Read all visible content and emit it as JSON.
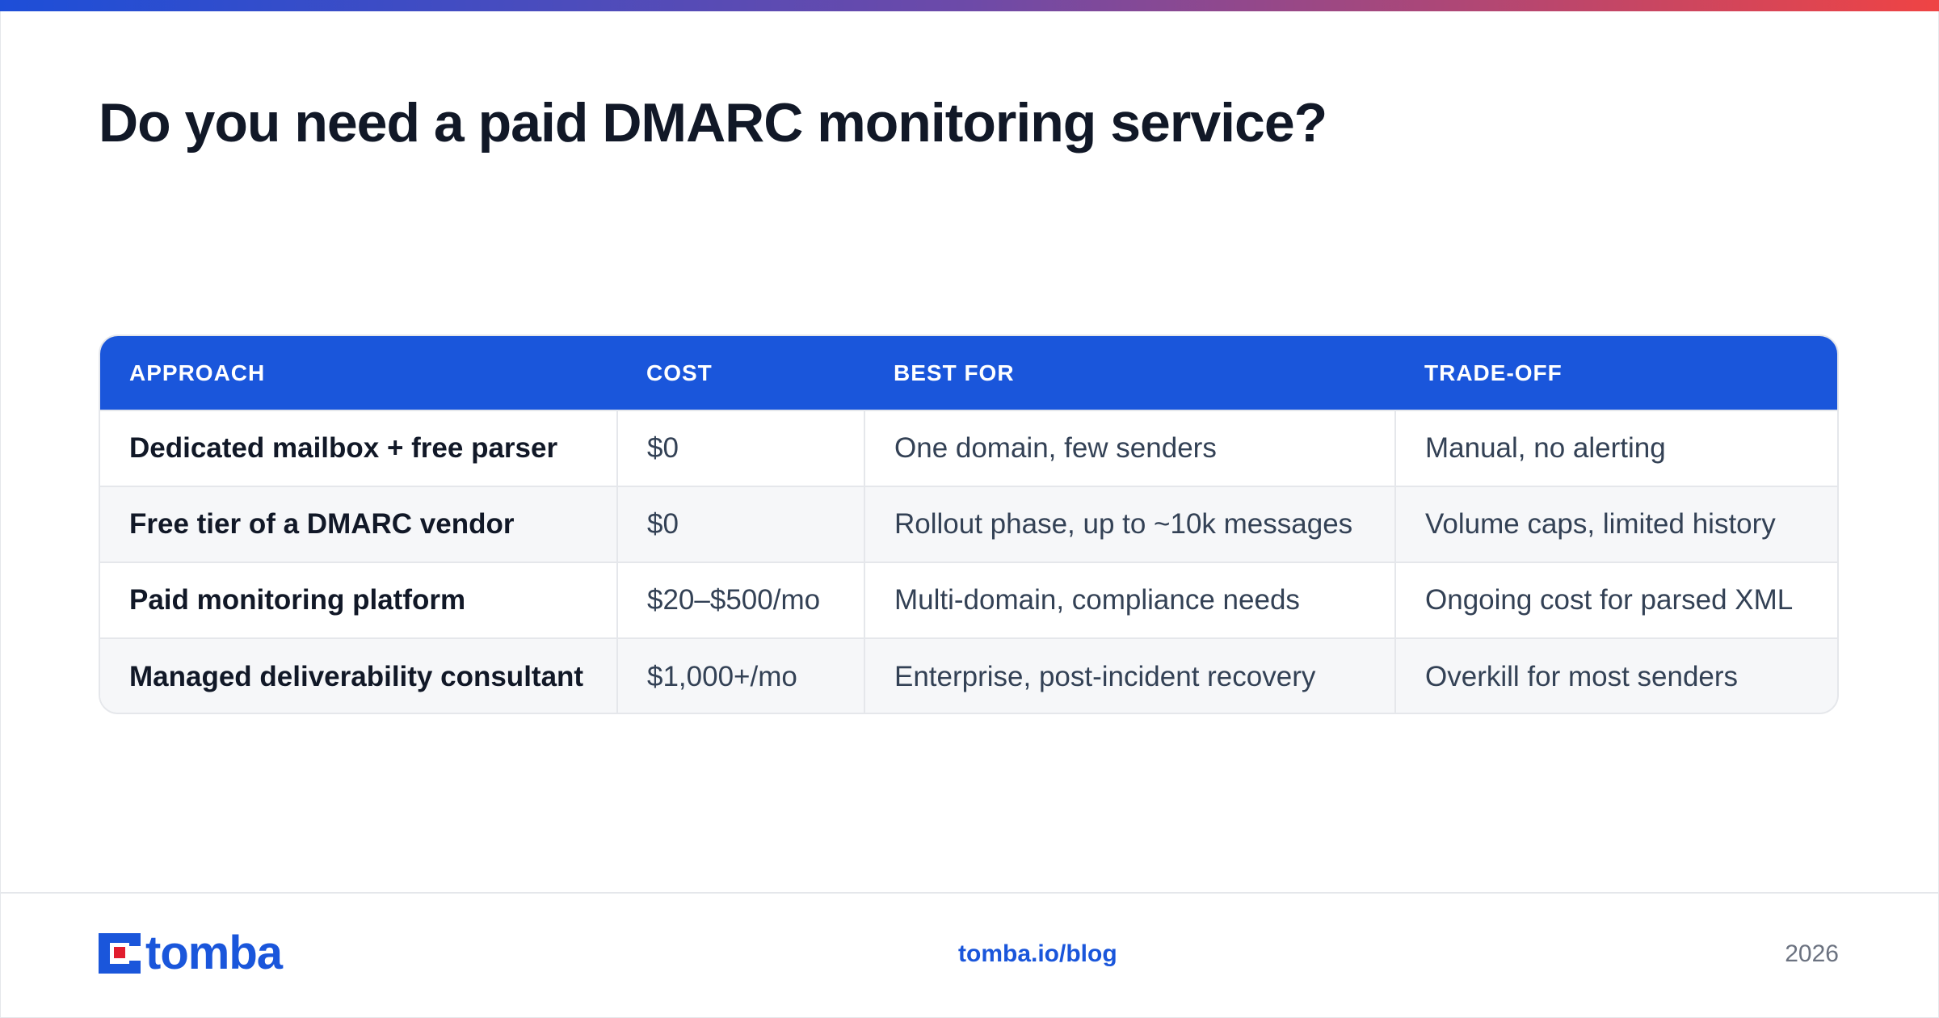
{
  "title": "Do you need a paid DMARC monitoring service?",
  "table": {
    "headers": [
      "APPROACH",
      "COST",
      "BEST FOR",
      "TRADE-OFF"
    ],
    "rows": [
      [
        "Dedicated mailbox + free parser",
        "$0",
        "One domain, few senders",
        "Manual, no alerting"
      ],
      [
        "Free tier of a DMARC vendor",
        "$0",
        "Rollout phase, up to ~10k messages",
        "Volume caps, limited history"
      ],
      [
        "Paid monitoring platform",
        "$20–$500/mo",
        "Multi-domain, compliance needs",
        "Ongoing cost for parsed XML"
      ],
      [
        "Managed deliverability consultant",
        "$1,000+/mo",
        "Enterprise, post-incident recovery",
        "Overkill for most senders"
      ]
    ]
  },
  "footer": {
    "brand": "tomba",
    "link": "tomba.io/blog",
    "year": "2026"
  },
  "colors": {
    "accent": "#1a56db",
    "gradient_start": "#1d4ed8",
    "gradient_end": "#ef4444",
    "logo_mark_red": "#e11d2e"
  },
  "icons": {
    "logo": "tomba-logo-icon"
  }
}
